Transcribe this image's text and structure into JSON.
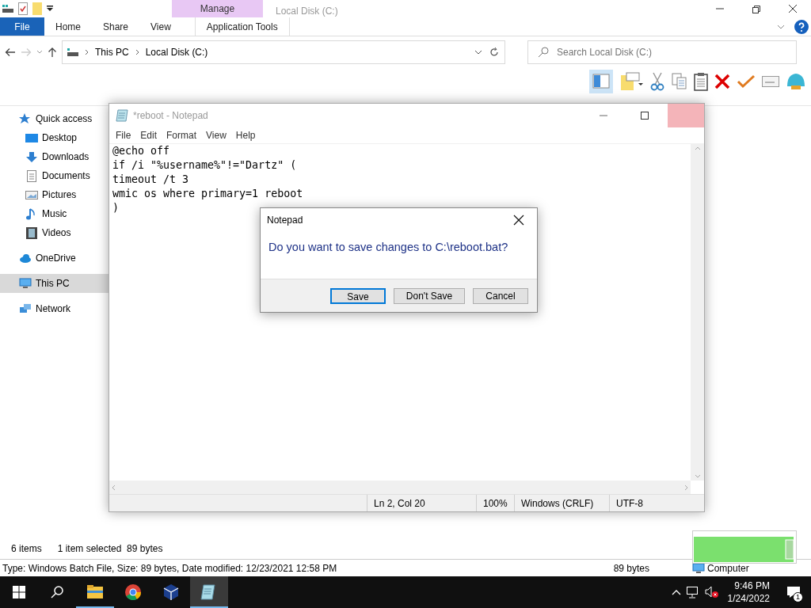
{
  "explorer": {
    "title": "Local Disk (C:)",
    "context_group": "Manage",
    "ribbon_tabs": [
      {
        "label": "File",
        "kind": "file",
        "selected": false
      },
      {
        "label": "Home",
        "kind": "tab",
        "selected": false
      },
      {
        "label": "Share",
        "kind": "tab",
        "selected": false
      },
      {
        "label": "View",
        "kind": "tab",
        "selected": false
      },
      {
        "label": "Application Tools",
        "kind": "context",
        "selected": false
      }
    ],
    "breadcrumb": [
      "This PC",
      "Local Disk (C:)"
    ],
    "search": {
      "placeholder": "Search Local Disk (C:)"
    },
    "nav": [
      {
        "label": "Quick access",
        "selected": false,
        "children": [
          {
            "label": "Desktop",
            "selected": false
          },
          {
            "label": "Downloads",
            "selected": false
          },
          {
            "label": "Documents",
            "selected": false
          },
          {
            "label": "Pictures",
            "selected": false
          },
          {
            "label": "Music",
            "selected": false
          },
          {
            "label": "Videos",
            "selected": false
          }
        ]
      },
      {
        "label": "OneDrive",
        "selected": false
      },
      {
        "label": "This PC",
        "selected": true
      },
      {
        "label": "Network",
        "selected": false
      }
    ],
    "status": [
      "6 items",
      "1 item selected  89 bytes"
    ],
    "details_bar": {
      "info": "Type: Windows Batch File, Size: 89 bytes, Date modified: 12/23/2021 12:58 PM",
      "size": "89 bytes",
      "location": "Computer"
    }
  },
  "notepad": {
    "title": "*reboot - Notepad",
    "menu": [
      "File",
      "Edit",
      "Format",
      "View",
      "Help"
    ],
    "lines": [
      "@echo off",
      "if /i \"%username%\"!=\"Dartz\" (",
      "timeout /t 3",
      "wmic os where primary=1 reboot",
      ")"
    ],
    "status": [
      "Ln 2, Col 20",
      "100%",
      "Windows (CRLF)",
      "UTF-8"
    ]
  },
  "dialog": {
    "title": "Notepad",
    "message": "Do you want to save changes to C:\\reboot.bat?",
    "buttons": [
      {
        "label": "Save",
        "selected": true
      },
      {
        "label": "Don't Save",
        "selected": false
      },
      {
        "label": "Cancel",
        "selected": false
      }
    ]
  },
  "taskbar": {
    "apps": [
      {
        "running": true,
        "selected": false
      },
      {
        "running": false,
        "selected": false
      },
      {
        "running": false,
        "selected": false
      },
      {
        "running": true,
        "selected": true
      }
    ],
    "time": "9:46 PM",
    "date": "1/24/2022",
    "notifications": "1"
  }
}
